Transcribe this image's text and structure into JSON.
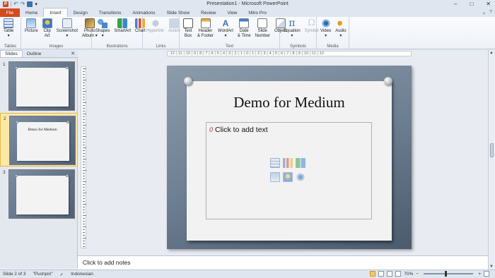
{
  "window": {
    "title": "Presentation1 - Microsoft PowerPoint",
    "controls": [
      "–",
      "□",
      "✕"
    ]
  },
  "quick_access": {
    "app_icon": "powerpoint-icon",
    "app_letter": "P",
    "undo": "↶",
    "redo": "↷",
    "more": "▾"
  },
  "tabs": [
    "File",
    "Home",
    "Insert",
    "Design",
    "Transitions",
    "Animations",
    "Slide Show",
    "Review",
    "View",
    "Nitro Pro"
  ],
  "active_tab": "Insert",
  "ribbon_right": {
    "minimize": "▵",
    "help": "?"
  },
  "ribbon": {
    "groups": [
      {
        "label": "Tables",
        "buttons": [
          {
            "label": "Table",
            "sub": "▾",
            "icon": "table-icon"
          }
        ]
      },
      {
        "label": "Images",
        "buttons": [
          {
            "label": "Picture",
            "icon": "picture-icon"
          },
          {
            "label": "Clip",
            "label2": "Art",
            "icon": "clipart-icon"
          },
          {
            "label": "Screenshot",
            "sub": "▾",
            "icon": "screenshot-icon"
          },
          {
            "label": "Photo",
            "label2": "Album ▾",
            "icon": "photo-album-icon"
          }
        ]
      },
      {
        "label": "Illustrations",
        "buttons": [
          {
            "label": "Shapes",
            "sub": "▾",
            "icon": "shapes-icon"
          },
          {
            "label": "SmartArt",
            "icon": "smartart-icon"
          },
          {
            "label": "Chart",
            "icon": "chart-icon"
          }
        ]
      },
      {
        "label": "Links",
        "buttons": [
          {
            "label": "Hyperlink",
            "icon": "hyperlink-icon",
            "disabled": true
          },
          {
            "label": "Action",
            "icon": "action-icon",
            "disabled": true
          }
        ]
      },
      {
        "label": "Text",
        "buttons": [
          {
            "label": "Text",
            "label2": "Box",
            "icon": "textbox-icon"
          },
          {
            "label": "Header",
            "label2": "& Footer",
            "icon": "header-footer-icon"
          },
          {
            "label": "WordArt",
            "sub": "▾",
            "icon": "wordart-icon"
          },
          {
            "label": "Date",
            "label2": "& Time",
            "icon": "date-time-icon"
          },
          {
            "label": "Slide",
            "label2": "Number",
            "icon": "slide-number-icon"
          },
          {
            "label": "Object",
            "icon": "object-icon"
          }
        ]
      },
      {
        "label": "Symbols",
        "buttons": [
          {
            "label": "Equation",
            "sub": "▾",
            "icon": "equation-icon",
            "glyph": "π"
          },
          {
            "label": "Symbol",
            "icon": "symbol-icon",
            "glyph": "Ω",
            "disabled": true
          }
        ]
      },
      {
        "label": "Media",
        "buttons": [
          {
            "label": "Video",
            "sub": "▾",
            "icon": "video-icon"
          },
          {
            "label": "Audio",
            "sub": "▾",
            "icon": "audio-icon"
          }
        ]
      }
    ]
  },
  "pane": {
    "tabs": [
      "Slides",
      "Outline"
    ],
    "active": "Slides",
    "close": "✕",
    "thumbnails": [
      {
        "num": "1",
        "text": ""
      },
      {
        "num": "2",
        "text": "Demo for Medium"
      },
      {
        "num": "3",
        "text": ""
      }
    ],
    "selected_index": 1
  },
  "ruler_text": "·12·¦·11·¦·10·¦·9·¦·8·¦·7·¦·6·¦·5·¦·4·¦·3·¦·2·¦·1·¦·0·¦·1·¦·2·¦·3·¦·4·¦·5·¦·6·¦·7·¦·8·¦·9·¦·10·¦·11·¦·12·",
  "slide": {
    "title": "Demo for Medium",
    "bullet_marker": "0",
    "content_placeholder": "Click to add text",
    "placeholder_icons": [
      "insert-table-icon",
      "insert-chart-icon",
      "insert-smartart-icon",
      "insert-picture-icon",
      "insert-clipart-icon",
      "insert-media-icon"
    ]
  },
  "notes_placeholder": "Click to add notes",
  "status": {
    "slide_info": "Slide 2 of 3",
    "theme": "\"Pushpin\"",
    "language": "Indonesian",
    "zoom": "70%",
    "zoom_out": "−",
    "zoom_in": "+"
  }
}
